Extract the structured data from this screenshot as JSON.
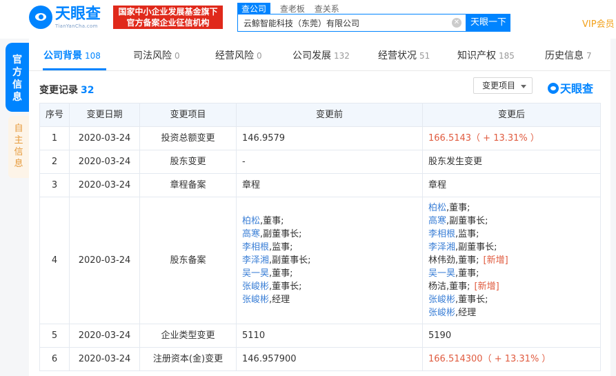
{
  "header": {
    "logo_text": "天眼查",
    "logo_sub": "TianYanCha.com",
    "gov_badge_line1": "国家中小企业发展基金旗下",
    "gov_badge_line2": "官方备案企业征信机构",
    "search_tabs": [
      "查公司",
      "查老板",
      "查关系"
    ],
    "search_value": "云鲸智能科技（东莞）有限公司",
    "search_button": "天眼一下",
    "vip": "VIP会员"
  },
  "side_tabs": {
    "active": [
      "官",
      "方",
      "信",
      "息"
    ],
    "inactive": [
      "自",
      "主",
      "信",
      "息"
    ]
  },
  "nav": [
    {
      "label": "公司背景",
      "count": "108"
    },
    {
      "label": "司法风险",
      "count": "0"
    },
    {
      "label": "经营风险",
      "count": "0"
    },
    {
      "label": "公司发展",
      "count": "132"
    },
    {
      "label": "经营状况",
      "count": "51"
    },
    {
      "label": "知识产权",
      "count": "185"
    },
    {
      "label": "历史信息",
      "count": "7"
    }
  ],
  "section": {
    "title": "变更记录",
    "count": "32",
    "dropdown": "变更项目",
    "watermark": "天眼查"
  },
  "table": {
    "headers": [
      "序号",
      "变更日期",
      "变更项目",
      "变更前",
      "变更后"
    ],
    "rows": [
      {
        "no": "1",
        "date": "2020-03-24",
        "item": "投资总额变更",
        "before": "146.9579",
        "after_value": "166.5143",
        "after_note": "（ + 13.31% ）"
      },
      {
        "no": "2",
        "date": "2020-03-24",
        "item": "股东变更",
        "before": "-",
        "after": "股东发生变更"
      },
      {
        "no": "3",
        "date": "2020-03-24",
        "item": "章程备案",
        "before": "章程",
        "after": "章程"
      },
      {
        "no": "4",
        "date": "2020-03-24",
        "item": "股东备案",
        "before_list": [
          {
            "name": "柏松",
            "role": ",董事;"
          },
          {
            "name": "高寒",
            "role": ",副董事长;"
          },
          {
            "name": "李相根",
            "role": ",监事;"
          },
          {
            "name": "李泽湘",
            "role": ",副董事长;"
          },
          {
            "name": "吴一昊",
            "role": ",董事;"
          },
          {
            "name": "张峻彬",
            "role": ",董事长;"
          },
          {
            "name": "张峻彬",
            "role": ",经理"
          }
        ],
        "after_list": [
          {
            "name": "柏松",
            "role": ",董事;",
            "tag": ""
          },
          {
            "name": "高寒",
            "role": ",副董事长;",
            "tag": ""
          },
          {
            "name": "李相根",
            "role": ",监事;",
            "tag": ""
          },
          {
            "name": "李泽湘",
            "role": ",副董事长;",
            "tag": ""
          },
          {
            "name": "林伟劲",
            "role": ",董事;",
            "tag": "[新增]",
            "plain": true
          },
          {
            "name": "吴一昊",
            "role": ",董事;",
            "tag": ""
          },
          {
            "name": "杨洁",
            "role": ",董事;",
            "tag": "[新增]",
            "plain": true
          },
          {
            "name": "张峻彬",
            "role": ",董事长;",
            "tag": ""
          },
          {
            "name": "张峻彬",
            "role": ",经理",
            "tag": ""
          }
        ]
      },
      {
        "no": "5",
        "date": "2020-03-24",
        "item": "企业类型变更",
        "before": "5110",
        "after": "5190"
      },
      {
        "no": "6",
        "date": "2020-03-24",
        "item": "注册资本(金)变更",
        "before": "146.957900",
        "after_value": "166.514300",
        "after_note": "（ + 13.31% ）"
      }
    ]
  }
}
